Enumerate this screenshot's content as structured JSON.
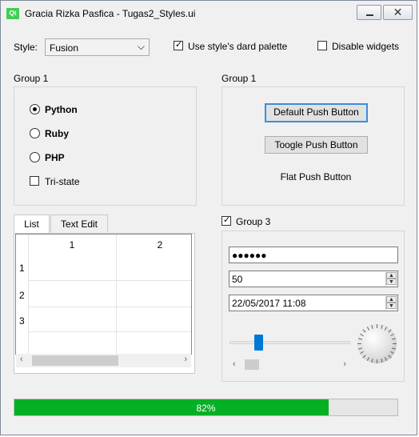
{
  "window": {
    "title": "Gracia Rizka Pasfica - Tugas2_Styles.ui",
    "icon_text": "Qt",
    "close_glyph": "✕"
  },
  "top": {
    "style_label": "Style:",
    "style_value": "Fusion",
    "palette_label": "Use style's dard palette",
    "palette_checked": true,
    "disable_label": "Disable widgets",
    "disable_checked": false
  },
  "group1_left": {
    "title": "Group 1",
    "radios": [
      {
        "label": "Python",
        "checked": true
      },
      {
        "label": "Ruby",
        "checked": false
      },
      {
        "label": "PHP",
        "checked": false
      }
    ],
    "tristate_label": "Tri-state"
  },
  "group1_right": {
    "title": "Group 1",
    "default_button": "Default Push Button",
    "toggle_button": "Toogle Push Button",
    "flat_button": "Flat Push Button"
  },
  "tabs": {
    "items": [
      {
        "label": "List"
      },
      {
        "label": "Text Edit"
      }
    ],
    "table": {
      "columns": [
        "1",
        "2"
      ],
      "rows": [
        "1",
        "2",
        "3"
      ]
    }
  },
  "group3": {
    "title": "Group 3",
    "checked": true,
    "password": "●●●●●●",
    "spin_value": "50",
    "datetime": "22/05/2017 11:08",
    "slider_value": 0.22
  },
  "progress": {
    "value": 82,
    "label": "82%",
    "color": "#06b025"
  },
  "colors": {
    "accent": "#0078d7",
    "progress": "#06b025"
  }
}
